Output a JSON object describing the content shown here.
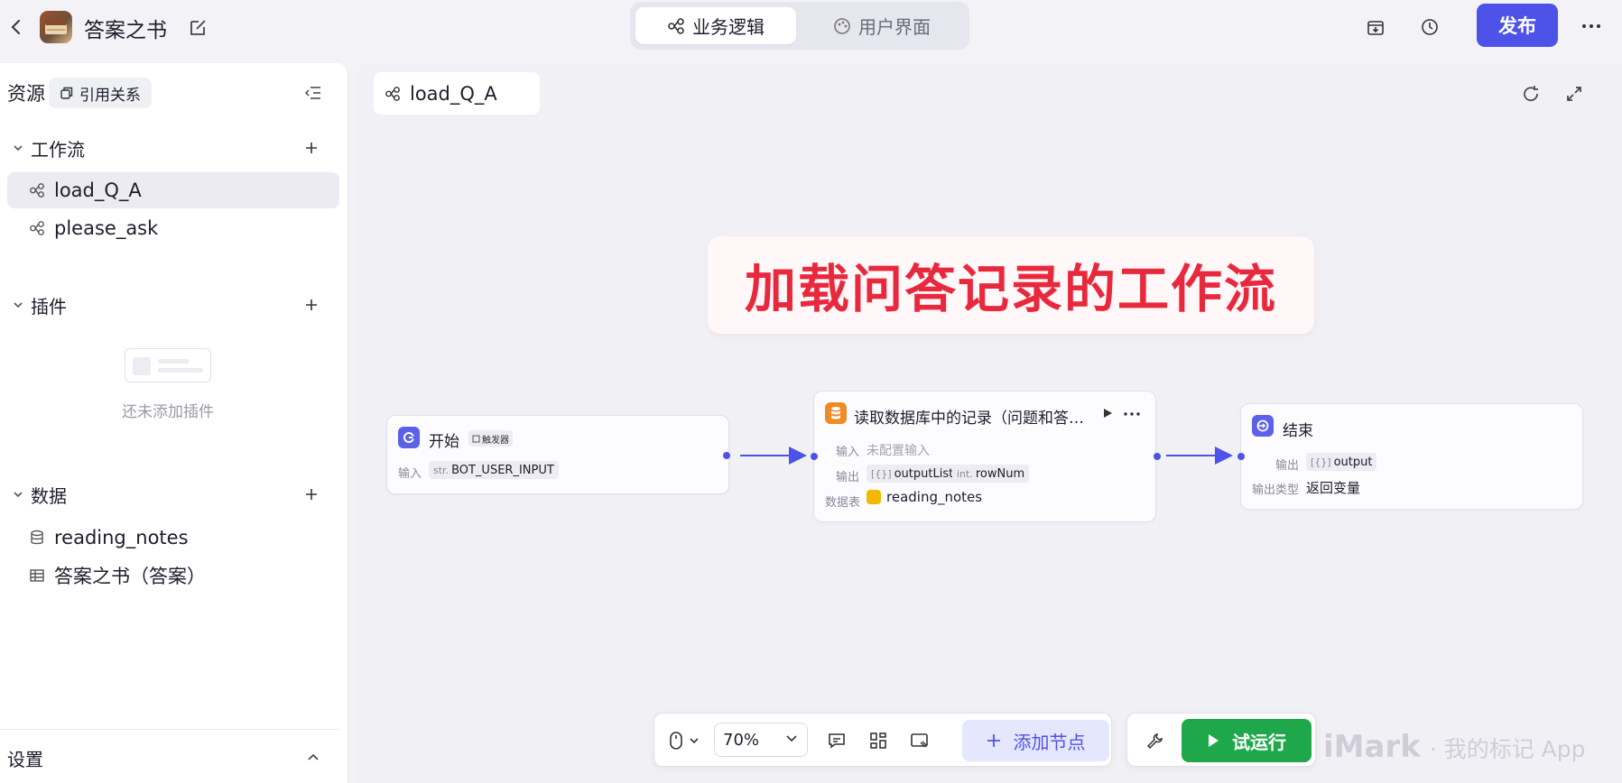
{
  "header": {
    "app_title": "答案之书",
    "tabs": [
      {
        "label": "业务逻辑",
        "active": true
      },
      {
        "label": "用户界面",
        "active": false
      }
    ],
    "publish_label": "发布",
    "accent_color": "#4d53e8"
  },
  "sidebar": {
    "resources_label": "资源",
    "references_label": "引用关系",
    "sections": {
      "workflow": {
        "label": "工作流",
        "items": [
          "load_Q_A",
          "please_ask"
        ]
      },
      "plugins": {
        "label": "插件",
        "empty_text": "还未添加插件"
      },
      "data": {
        "label": "数据",
        "items": [
          "reading_notes",
          "答案之书（答案）"
        ]
      }
    },
    "settings_label": "设置"
  },
  "canvas": {
    "workflow_tab": "load_Q_A",
    "banner_text": "加载问答记录的工作流",
    "nodes": {
      "start": {
        "title": "开始",
        "trigger_tag": "触发器",
        "input_label": "输入",
        "input_type": "str.",
        "input_value": "BOT_USER_INPUT"
      },
      "db": {
        "title": "读取数据库中的记录（问题和答…",
        "input_label": "输入",
        "input_value": "未配置输入",
        "output_label": "输出",
        "outputs": [
          {
            "type": "[{}]",
            "name": "outputList"
          },
          {
            "type": "int.",
            "name": "rowNum"
          }
        ],
        "table_label": "数据表",
        "table_value": "reading_notes"
      },
      "end": {
        "title": "结束",
        "output_label": "输出",
        "output_type": "[{}]",
        "output_value": "output",
        "output_kind_label": "输出类型",
        "output_kind_value": "返回变量"
      }
    }
  },
  "toolbar": {
    "zoom": "70%",
    "add_node_label": "添加节点",
    "run_label": "试运行",
    "run_color": "#1ea84b"
  },
  "watermark": {
    "brand": "iMark",
    "suffix": "· 我的标记 App"
  }
}
